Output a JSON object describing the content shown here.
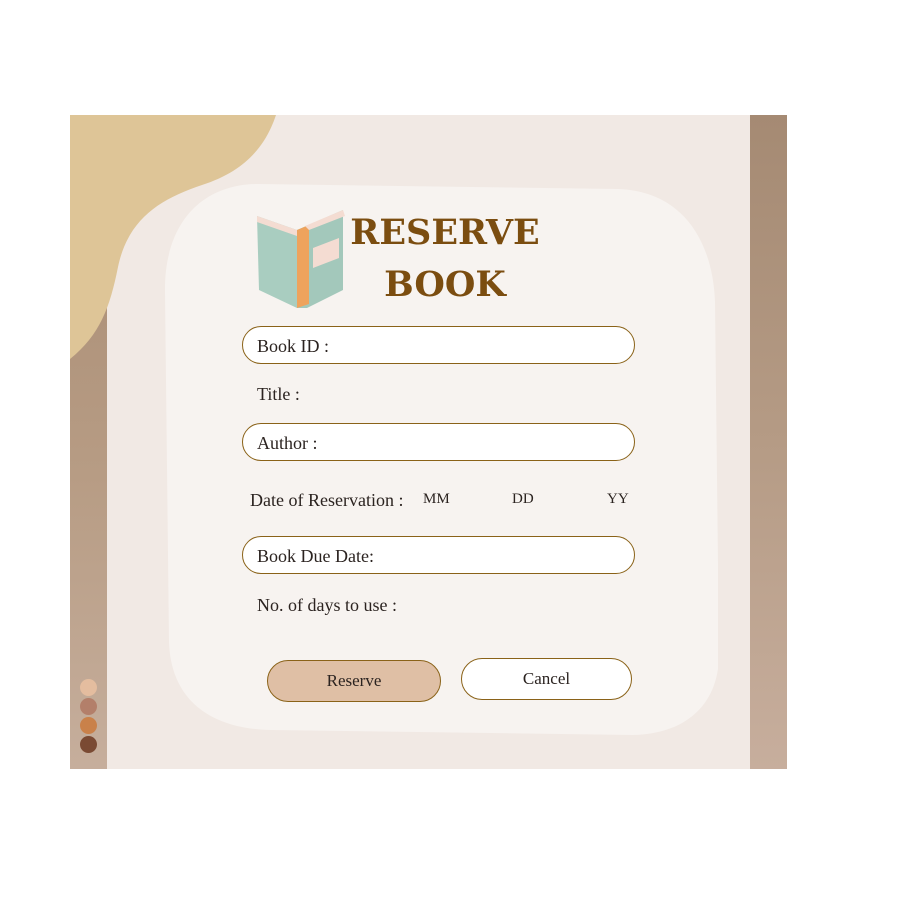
{
  "form": {
    "title_line1": "RESERVE",
    "title_line2": "BOOK",
    "book_id_label": "Book ID :",
    "title_label": "Title :",
    "author_label": "Author :",
    "reservation_date_label": "Date of Reservation :",
    "date_parts": [
      "MM",
      "DD",
      "YY"
    ],
    "due_date_label": "Book Due Date:",
    "days_label": "No. of days to use :"
  },
  "buttons": {
    "reserve": "Reserve",
    "cancel": "Cancel"
  },
  "palette": {
    "accent_title": "#7b4d10",
    "reserve_button": "#dfbfa5",
    "swatches": [
      "#e4bd9f",
      "#b37f6a",
      "#c9814a",
      "#7a4a33"
    ]
  },
  "icons": {
    "book": "open-book-icon"
  }
}
